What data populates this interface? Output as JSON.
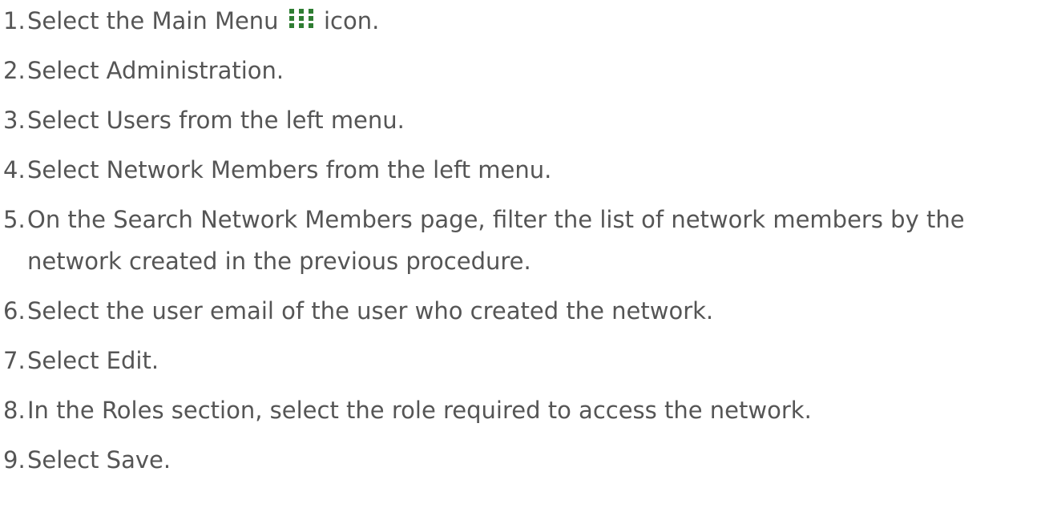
{
  "steps": [
    {
      "num": "1.",
      "before": "Select the Main Menu",
      "icon": "main-menu-grid-icon",
      "after": "icon."
    },
    {
      "num": "2.",
      "text": "Select Administration."
    },
    {
      "num": "3.",
      "text": "Select Users from the left menu."
    },
    {
      "num": "4.",
      "text": "Select Network Members from the left menu."
    },
    {
      "num": "5.",
      "text": "On the Search Network Members page, filter the list of network members by the network created in the previous procedure."
    },
    {
      "num": "6.",
      "text": "Select the user email of the user who created the network."
    },
    {
      "num": "7.",
      "text": "Select Edit."
    },
    {
      "num": "8.",
      "text": "In the Roles section, select the role required to access the network."
    },
    {
      "num": "9.",
      "text": "Select Save."
    }
  ],
  "colors": {
    "text": "#555555",
    "icon": "#2e7d32"
  }
}
